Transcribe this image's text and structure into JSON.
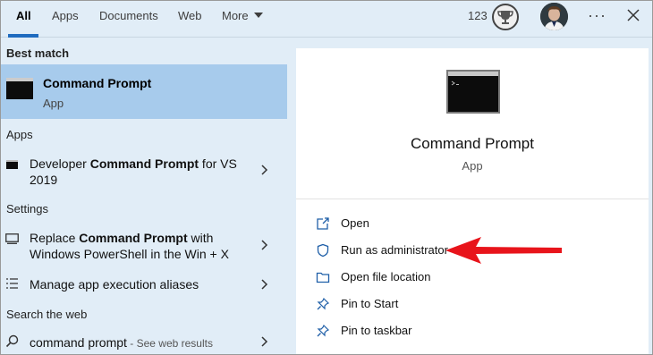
{
  "tabs": {
    "all": "All",
    "apps": "Apps",
    "documents": "Documents",
    "web": "Web",
    "more": "More"
  },
  "account": {
    "points": "123"
  },
  "header_actions": {
    "more_options": "···"
  },
  "results": {
    "best_match_header": "Best match",
    "best_match": {
      "title": "Command Prompt",
      "subtitle": "App"
    },
    "apps_header": "Apps",
    "apps": [
      {
        "prefix": "Developer ",
        "bold": "Command Prompt",
        "suffix": " for VS",
        "line2": "2019"
      }
    ],
    "settings_header": "Settings",
    "settings": [
      {
        "prefix": "Replace ",
        "bold": "Command Prompt",
        "suffix": " with",
        "line2": "Windows PowerShell in the Win + X"
      },
      {
        "label": "Manage app execution aliases"
      }
    ],
    "web_header": "Search the web",
    "web": {
      "query": "command prompt",
      "suffix": " - See web results"
    }
  },
  "preview": {
    "title": "Command Prompt",
    "subtitle": "App",
    "actions": [
      {
        "label": "Open",
        "icon": "open-icon"
      },
      {
        "label": "Run as administrator",
        "icon": "shield-icon"
      },
      {
        "label": "Open file location",
        "icon": "folder-icon"
      },
      {
        "label": "Pin to Start",
        "icon": "pin-icon"
      },
      {
        "label": "Pin to taskbar",
        "icon": "pin-icon"
      }
    ]
  },
  "colors": {
    "background": "#e1edf7",
    "selected": "#a7cbec",
    "accent": "#1f6bbf",
    "annotation_arrow": "#e8141b"
  }
}
